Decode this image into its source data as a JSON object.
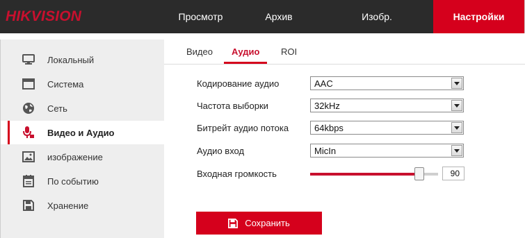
{
  "brand": {
    "logo_text": "HIKVISION",
    "accent": "#d5001c"
  },
  "top_nav": {
    "items": [
      {
        "label": "Просмотр"
      },
      {
        "label": "Архив"
      },
      {
        "label": "Изобр."
      },
      {
        "label": "Настройки",
        "active": true
      }
    ]
  },
  "sidebar": {
    "items": [
      {
        "label": "Локальный",
        "icon": "monitor-icon"
      },
      {
        "label": "Система",
        "icon": "system-window-icon"
      },
      {
        "label": "Сеть",
        "icon": "globe-icon"
      },
      {
        "label": "Видео и Аудио",
        "icon": "video-audio-icon",
        "active": true
      },
      {
        "label": "изображение",
        "icon": "image-icon"
      },
      {
        "label": "По событию",
        "icon": "calendar-icon"
      },
      {
        "label": "Хранение",
        "icon": "save-disk-icon"
      }
    ]
  },
  "tabs": [
    {
      "label": "Видео"
    },
    {
      "label": "Аудио",
      "active": true
    },
    {
      "label": "ROI"
    }
  ],
  "form": {
    "audio_encoding": {
      "label": "Кодирование аудио",
      "value": "AAC"
    },
    "sample_rate": {
      "label": "Частота выборки",
      "value": "32kHz"
    },
    "audio_bitrate": {
      "label": "Битрейт аудио потока",
      "value": "64kbps"
    },
    "audio_input": {
      "label": "Аудио вход",
      "value": "MicIn"
    },
    "input_volume": {
      "label": "Входная громкость",
      "value": "90"
    }
  },
  "save_button": {
    "label": "Сохранить",
    "icon": "save-disk-icon"
  }
}
